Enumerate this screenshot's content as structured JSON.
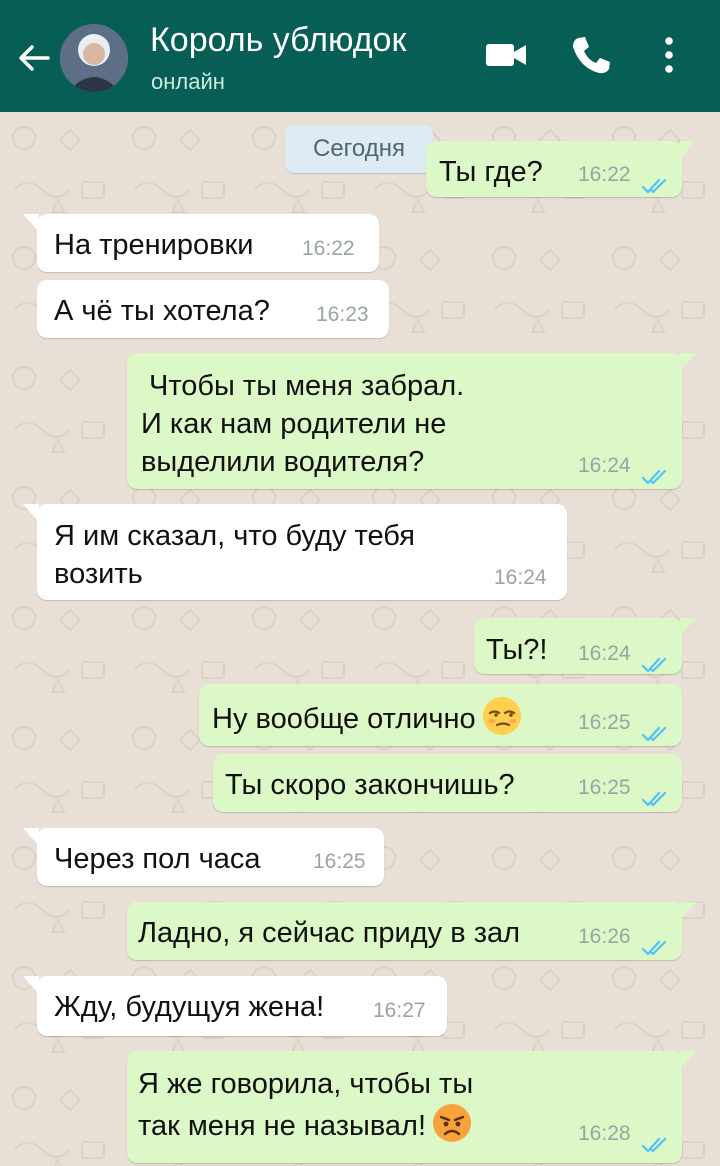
{
  "header": {
    "back_icon": "arrow-left-icon",
    "contact_name": "Король ублюдок",
    "status": "онлайн",
    "video_icon": "video-call-icon",
    "call_icon": "phone-icon",
    "menu_icon": "more-vert-icon",
    "bar_color": "#075e54"
  },
  "chat": {
    "date_divider": "Сегодня",
    "incoming_color": "#ffffff",
    "outgoing_color": "#dcf8c6",
    "read_tick_color": "#4fc3f7",
    "messages": [
      {
        "direction": "out",
        "lines": [
          "Ты где?"
        ],
        "time": "16:22",
        "read": true
      },
      {
        "direction": "in",
        "lines": [
          "На тренировки"
        ],
        "time": "16:22"
      },
      {
        "direction": "in",
        "lines": [
          "А чё ты хотела?"
        ],
        "time": "16:23"
      },
      {
        "direction": "out",
        "lines": [
          "Чтобы ты меня забрал.",
          "И как нам родители не",
          "выделили водителя?"
        ],
        "time": "16:24",
        "read": true
      },
      {
        "direction": "in",
        "lines": [
          "Я им сказал, что буду тебя",
          "возить"
        ],
        "time": "16:24"
      },
      {
        "direction": "out",
        "lines": [
          "Ты?!"
        ],
        "time": "16:24",
        "read": true
      },
      {
        "direction": "out",
        "lines": [
          "Ну вообще отлично"
        ],
        "emoji": "unamused-face",
        "time": "16:25",
        "read": true
      },
      {
        "direction": "out",
        "lines": [
          "Ты скоро закончишь?"
        ],
        "time": "16:25",
        "read": true
      },
      {
        "direction": "in",
        "lines": [
          "Через пол часа"
        ],
        "time": "16:25"
      },
      {
        "direction": "out",
        "lines": [
          "Ладно, я сейчас приду в зал"
        ],
        "time": "16:26",
        "read": true
      },
      {
        "direction": "in",
        "lines": [
          "Жду, будущуя жена!"
        ],
        "time": "16:27"
      },
      {
        "direction": "out",
        "lines": [
          "Я же говорила, чтобы ты",
          "так меня не называл!"
        ],
        "emoji": "angry-face",
        "time": "16:28",
        "read": true
      }
    ]
  }
}
